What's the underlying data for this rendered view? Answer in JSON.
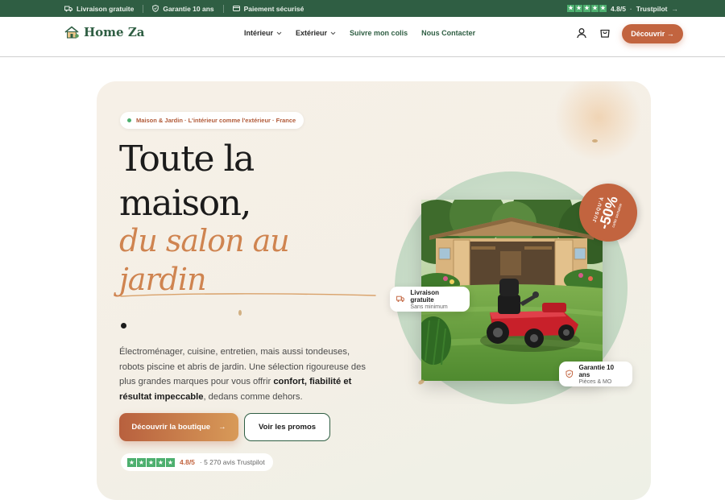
{
  "topbar": {
    "items": [
      {
        "icon": "truck-icon",
        "label": "Livraison gratuite"
      },
      {
        "icon": "shield-icon",
        "label": "Garantie 10 ans"
      },
      {
        "icon": "card-icon",
        "label": "Paiement sécurisé"
      }
    ],
    "rating_score": "4.8/5",
    "rating_source": "Trustpilot",
    "rating_arrow": "→"
  },
  "header": {
    "logo_text": "Home Za",
    "nav": [
      {
        "label": "Intérieur",
        "has_dropdown": true
      },
      {
        "label": "Extérieur",
        "has_dropdown": true
      },
      {
        "label": "Suivre mon colis",
        "has_dropdown": false
      },
      {
        "label": "Nous Contacter",
        "has_dropdown": false
      }
    ],
    "cta_label": "Découvrir →"
  },
  "hero": {
    "pill": "Maison & Jardin · L'intérieur comme l'extérieur · France",
    "title_line1": "Toute la",
    "title_line2": "maison,",
    "title_italic1": "du salon au",
    "title_italic2": "jardin",
    "desc_part1": "Électroménager, cuisine, entretien, mais aussi tondeuses, robots piscine et abris de jardin. Une sélection rigoureuse des plus grandes marques pour vous offrir ",
    "desc_bold1": "confort, fiabilité et résultat impeccable",
    "desc_part2": ", dedans comme dehors.",
    "btn_primary": "Découvrir la boutique",
    "btn_primary_arrow": "→",
    "btn_secondary": "Voir les promos",
    "rating_score": "4.8/5",
    "rating_text": "· 5 270 avis Trustpilot"
  },
  "visual": {
    "promo_top": "JUSQU'À",
    "promo_value": "-50%",
    "promo_bottom": "cette semaine",
    "card1_title": "Livraison gratuite",
    "card1_sub": "Sans minimum",
    "card2_title": "Garantie 10 ans",
    "card2_sub": "Pièces & MO"
  },
  "colors": {
    "brand_green": "#2f5e43",
    "accent_orange": "#c2643f",
    "italic_orange": "#cf8450",
    "trustpilot_green": "#4caf6e"
  }
}
